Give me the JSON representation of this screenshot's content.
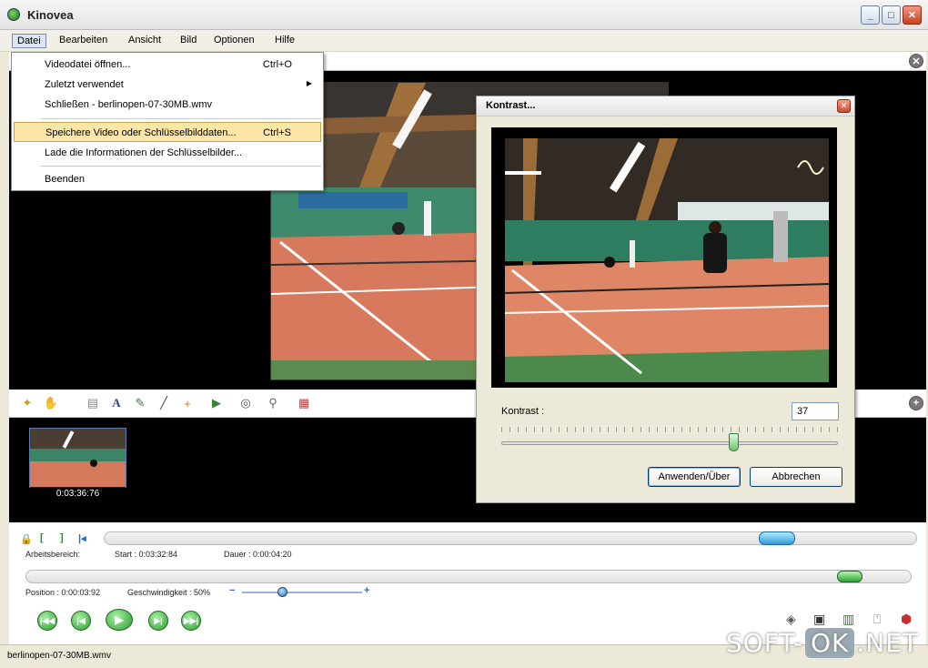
{
  "window": {
    "title": "Kinovea"
  },
  "menu": [
    "Datei",
    "Bearbeiten",
    "Ansicht",
    "Bild",
    "Optionen",
    "Hilfe"
  ],
  "datei_menu": {
    "open": {
      "label": "Videodatei öffnen...",
      "shortcut": "Ctrl+O"
    },
    "recent": {
      "label": "Zuletzt verwendet"
    },
    "close": {
      "label": "Schließen - berlinopen-07-30MB.wmv"
    },
    "save": {
      "label": "Speichere Video oder Schlüsselbilddaten...",
      "shortcut": "Ctrl+S"
    },
    "load": {
      "label": "Lade die Informationen der Schlüsselbilder..."
    },
    "exit": {
      "label": "Beenden"
    }
  },
  "thumbnail": {
    "time": "0:03:36:76"
  },
  "workspace": {
    "label": "Arbeitsbereich:",
    "start": "Start : 0:03:32:84",
    "duration": "Dauer : 0:00:04:20"
  },
  "playback": {
    "position": "Position : 0:00:03:92",
    "speed": "Geschwindigkeit : 50%",
    "speed_fraction": 0.5
  },
  "dialog": {
    "title": "Kontrast...",
    "label": "Kontrast :",
    "value": "37",
    "slider_fraction": 0.69,
    "apply": "Anwenden/Über",
    "cancel": "Abbrechen"
  },
  "status": {
    "file": "berlinopen-07-30MB.wmv"
  },
  "watermark": {
    "left": "SOFT-",
    "mid": "OK",
    "right": ".NET"
  }
}
